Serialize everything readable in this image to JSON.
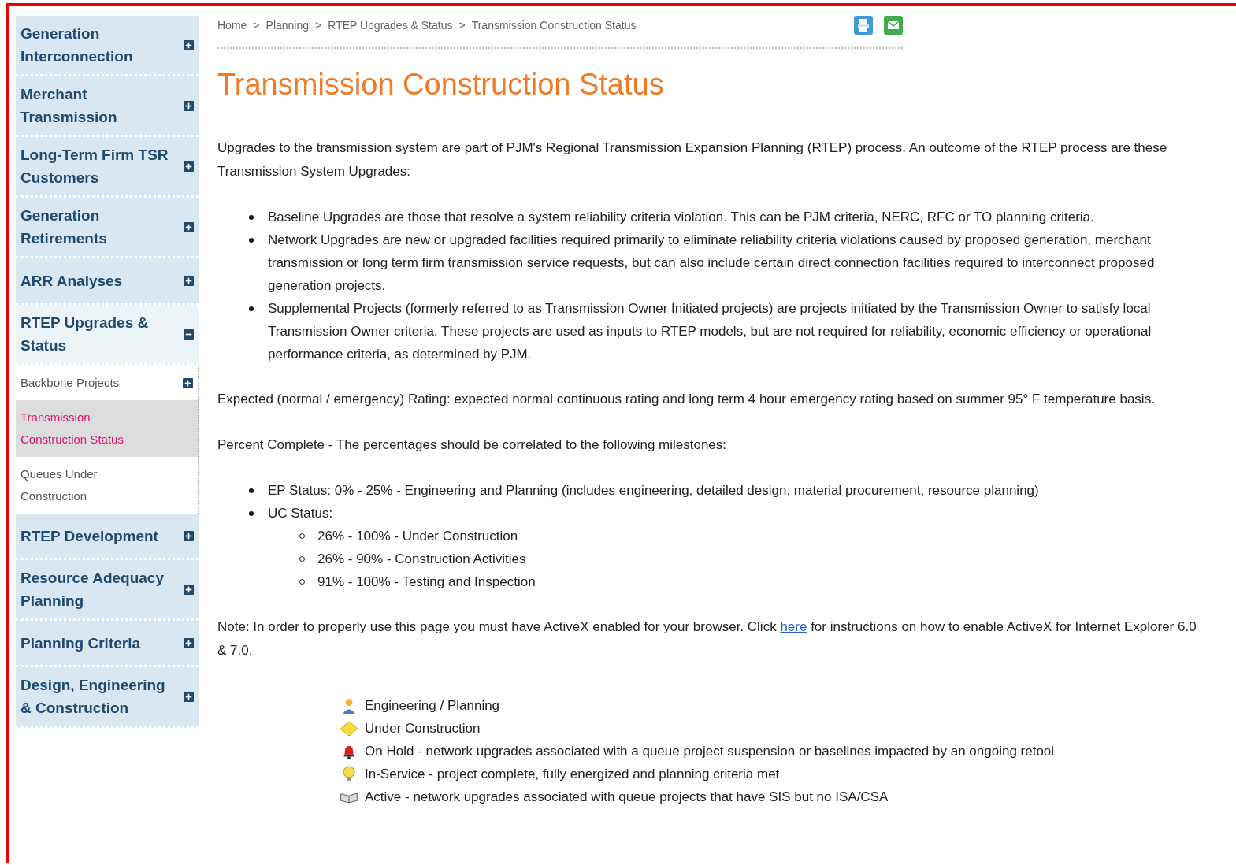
{
  "sidebar": {
    "items": [
      {
        "label": "Generation Interconnection",
        "expanded": false
      },
      {
        "label": "Merchant Transmission",
        "expanded": false
      },
      {
        "label": "Long-Term Firm TSR Customers",
        "expanded": false
      },
      {
        "label": "Generation Retirements",
        "expanded": false
      },
      {
        "label": "ARR Analyses",
        "expanded": false
      },
      {
        "label": "RTEP Upgrades & Status",
        "expanded": true,
        "children": [
          {
            "label": "Backbone Projects",
            "kind": "expandable",
            "selected": false
          },
          {
            "label": "Transmission Construction Status",
            "kind": "plain",
            "selected": true
          },
          {
            "label": "Queues Under Construction",
            "kind": "plain",
            "selected": false
          }
        ]
      },
      {
        "label": "RTEP Development",
        "expanded": false
      },
      {
        "label": "Resource Adequacy Planning",
        "expanded": false
      },
      {
        "label": "Planning Criteria",
        "expanded": false
      },
      {
        "label": "Design, Engineering & Construction",
        "expanded": false
      }
    ]
  },
  "breadcrumb": [
    "Home",
    "Planning",
    "RTEP Upgrades & Status",
    "Transmission Construction Status"
  ],
  "breadcrumb_separator": ">",
  "title": "Transmission Construction Status",
  "intro": "Upgrades to the transmission system are part of PJM's Regional Transmission Expansion Planning (RTEP) process. An outcome of the RTEP process are these Transmission System Upgrades:",
  "upgrade_types": [
    "Baseline Upgrades are those that resolve a system reliability criteria violation. This can be PJM criteria, NERC, RFC or TO planning criteria.",
    "Network Upgrades are new or upgraded facilities required primarily to eliminate reliability criteria violations caused by proposed generation, merchant transmission or long term firm transmission service requests, but can also include certain direct connection facilities required to interconnect proposed generation projects.",
    "Supplemental Projects (formerly referred to as Transmission Owner Initiated projects) are projects initiated by the Transmission Owner to satisfy local Transmission Owner criteria. These projects are used as inputs to RTEP models, but are not required for reliability, economic efficiency or operational performance criteria, as determined by PJM."
  ],
  "rating_note": "Expected (normal / emergency) Rating: expected normal continuous rating and long term 4 hour emergency rating based on summer 95° F temperature basis.",
  "percent_intro": "Percent Complete - The percentages should be correlated to the following milestones:",
  "milestones": [
    {
      "label": "EP Status: 0% - 25% - Engineering and Planning (includes engineering, detailed design, material procurement, resource planning)"
    },
    {
      "label": "UC Status:",
      "children": [
        {
          "label": "26% - 100% - Under Construction"
        },
        {
          "label": "26% - 90% - Construction Activities"
        },
        {
          "label": "91% - 100% - Testing and Inspection"
        }
      ]
    }
  ],
  "note": {
    "before": "Note: In order to properly use this page you must have ActiveX enabled for your browser. Click",
    "link": "here",
    "after": "for instructions on how to enable ActiveX for Internet Explorer 6.0 & 7.0."
  },
  "legend": [
    {
      "kind": "engineer",
      "label": "Engineering / Planning"
    },
    {
      "kind": "diamond",
      "label": "Under Construction"
    },
    {
      "kind": "alarm",
      "label": "On Hold - network upgrades associated with a queue project suspension or baselines impacted by an ongoing retool"
    },
    {
      "kind": "bulb",
      "label": "In-Service - project complete, fully energized and planning criteria met"
    },
    {
      "kind": "book",
      "label": "Active - network upgrades associated with queue projects that have SIS but no ISA/CSA"
    }
  ]
}
